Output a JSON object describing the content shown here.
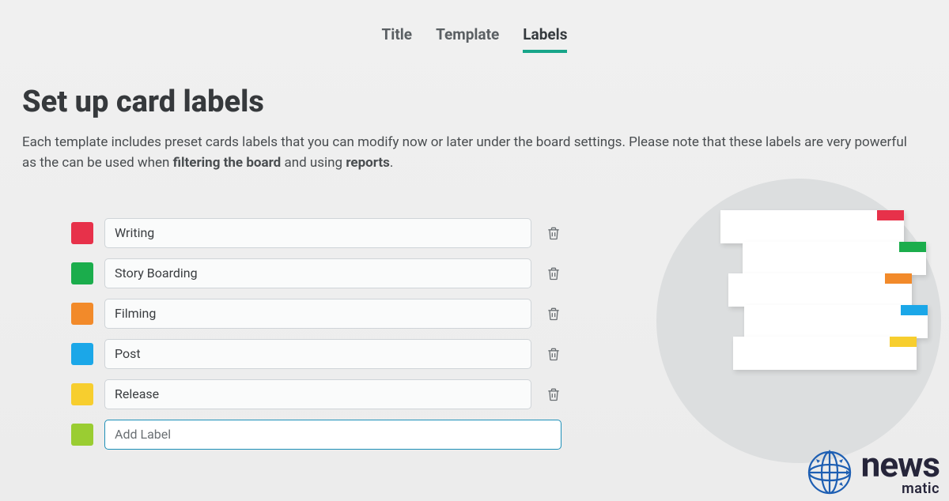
{
  "tabs": [
    {
      "label": "Title",
      "active": false
    },
    {
      "label": "Template",
      "active": false
    },
    {
      "label": "Labels",
      "active": true
    }
  ],
  "page_title": "Set up card labels",
  "description": {
    "part1": "Each template includes preset cards labels that you can modify now or later under the board settings. Please note that these labels are very powerful as the can be used when ",
    "bold1": "filtering the board",
    "part2": " and using ",
    "bold2": "reports",
    "part3": "."
  },
  "labels": [
    {
      "name": "Writing",
      "color": "#e7314a"
    },
    {
      "name": "Story Boarding",
      "color": "#1bad4c"
    },
    {
      "name": "Filming",
      "color": "#f28a2a"
    },
    {
      "name": "Post",
      "color": "#1ba7e8"
    },
    {
      "name": "Release",
      "color": "#f7ce2e"
    }
  ],
  "add_label": {
    "placeholder": "Add Label",
    "color": "#9acd32"
  },
  "preview_tags": [
    "#e7314a",
    "#1bad4c",
    "#f28a2a",
    "#1ba7e8",
    "#f7ce2e"
  ],
  "watermark": {
    "brand": "news",
    "sub": "matic"
  }
}
